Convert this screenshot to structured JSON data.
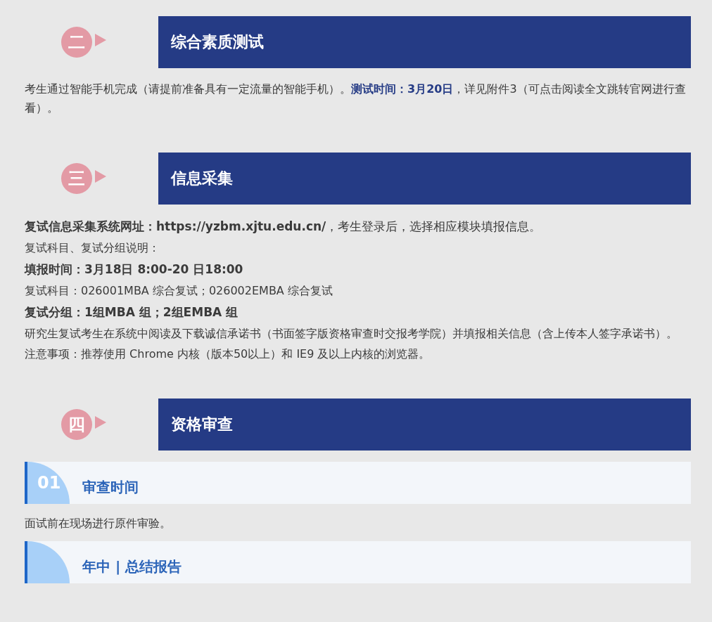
{
  "sections": [
    {
      "badge": "二",
      "title": "综合素质测试",
      "blocks": [
        {
          "kind": "text",
          "text": "考生通过智能手机完成（请提前准备具有一定流量的智能手机）。**测试时间：3月20日**，详见附件3（可点击阅读全文跳转官网进行查看）。"
        }
      ]
    },
    {
      "badge": "三",
      "title": "信息采集",
      "blocks": [
        {
          "kind": "lead",
          "text": "**复试信息采集系统网址：https://yzbm.xjtu.edu.cn/**，考生登录后，选择相应模块填报信息。"
        },
        {
          "kind": "text",
          "text": "复试科目、复试分组说明："
        },
        {
          "kind": "heading",
          "text": "填报时间：3月18日 8:00-20 日18:00"
        },
        {
          "kind": "text",
          "text": "复试科目：026001MBA 综合复试；026002EMBA 综合复试"
        },
        {
          "kind": "heading",
          "text": "复试分组：1组MBA 组；2组EMBA 组"
        },
        {
          "kind": "text",
          "text": "研究生复试考生在系统中阅读及下载诚信承诺书（书面签字版资格审查时交报考学院）并填报相关信息（含上传本人签字承诺书）。"
        },
        {
          "kind": "text",
          "text": "注意事项：推荐使用 Chrome 内核（版本50以上）和 IE9 及以上内核的浏览器。"
        }
      ]
    },
    {
      "badge": "四",
      "title": "资格审查",
      "blocks": [
        {
          "kind": "subheading",
          "number": "01",
          "text": "审查时间"
        },
        {
          "kind": "text",
          "text": "面试前在现场进行原件审验。"
        },
        {
          "kind": "subheading",
          "text": "年中 | 总结报告"
        }
      ]
    }
  ]
}
